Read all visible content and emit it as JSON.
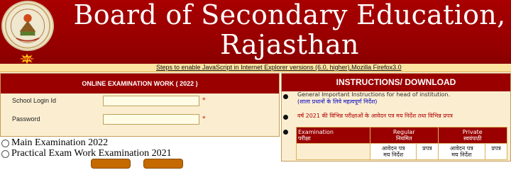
{
  "header": {
    "title_line1": "Board of Secondary Education,",
    "title_line2": "Rajasthan",
    "logo_icon": "board-emblem-logo",
    "new_badge_icon": "new-starburst-icon"
  },
  "js_notice": {
    "text": "Steps to enable JavaScript in Internet Explorer versions (6.0, higher),Mozilla Firefox3.0"
  },
  "login": {
    "heading": "ONLINE EXAMINATION WORK ( 2022 )",
    "school_login_label": "School Login Id",
    "school_login_value": "",
    "password_label": "Password",
    "password_value": "",
    "required_mark": "*",
    "options": [
      {
        "label": "Main Examination 2022",
        "selected": false
      },
      {
        "label": "Practical Exam Work Examination 2021",
        "selected": false
      }
    ]
  },
  "instructions": {
    "heading": "INSTRUCTIONS/ DOWNLOAD",
    "items": [
      {
        "en": "General Important Instructions for head of institution.",
        "hi": "(शाला प्रधानों के लिये महत्वपूर्ण निर्देश)"
      },
      {
        "hi": "वर्ष 2021 की विभिन्न परीक्षाओं के आवेदन पत्र मय निर्देश तथा विभिन्न प्रपत्र"
      }
    ],
    "table": {
      "col_exam": "Examination",
      "col_exam_hi": "परीक्षा",
      "col_regular": "Regular",
      "col_regular_hi": "नियमित",
      "col_private": "Private",
      "col_private_hi": "स्वयंपाठी",
      "sub_form": "आवेदन पत्र",
      "sub_form2": "मय निर्देश",
      "sub_prapatra": "प्रपत्र"
    }
  },
  "colors": {
    "brand_red": "#9a0000",
    "panel_bg": "#fbeed0",
    "strip_bg": "#fde3a2"
  }
}
